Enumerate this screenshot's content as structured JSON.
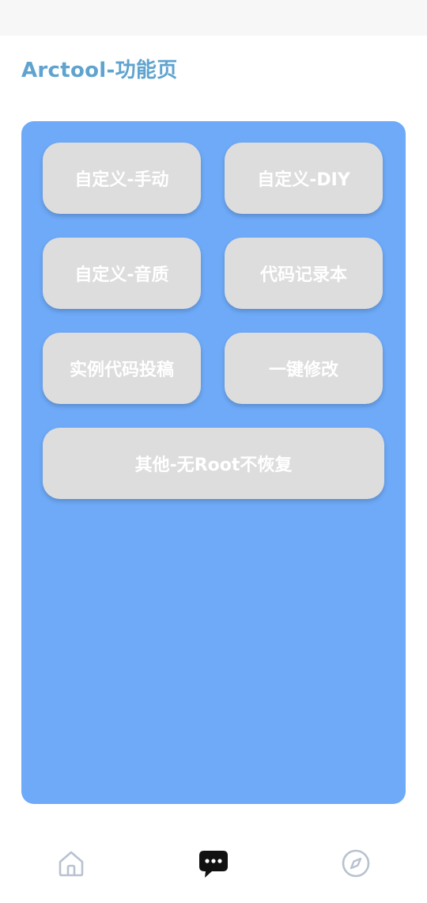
{
  "header": {
    "title": "Arctool-功能页"
  },
  "panel": {
    "color": "#6eaaf8",
    "buttons": {
      "custom_manual": "自定义-手动",
      "custom_diy": "自定义-DIY",
      "custom_sound": "自定义-音质",
      "code_notebook": "代码记录本",
      "code_submit": "实例代码投稿",
      "one_click_modify": "一键修改",
      "other_no_root": "其他-无Root不恢复"
    }
  },
  "bottom_nav": {
    "items": [
      {
        "icon": "home-icon",
        "active": false
      },
      {
        "icon": "chat-bubble-icon",
        "active": true
      },
      {
        "icon": "compass-icon",
        "active": false
      }
    ],
    "inactive_color": "#b9c2d0",
    "active_color": "#111111"
  }
}
